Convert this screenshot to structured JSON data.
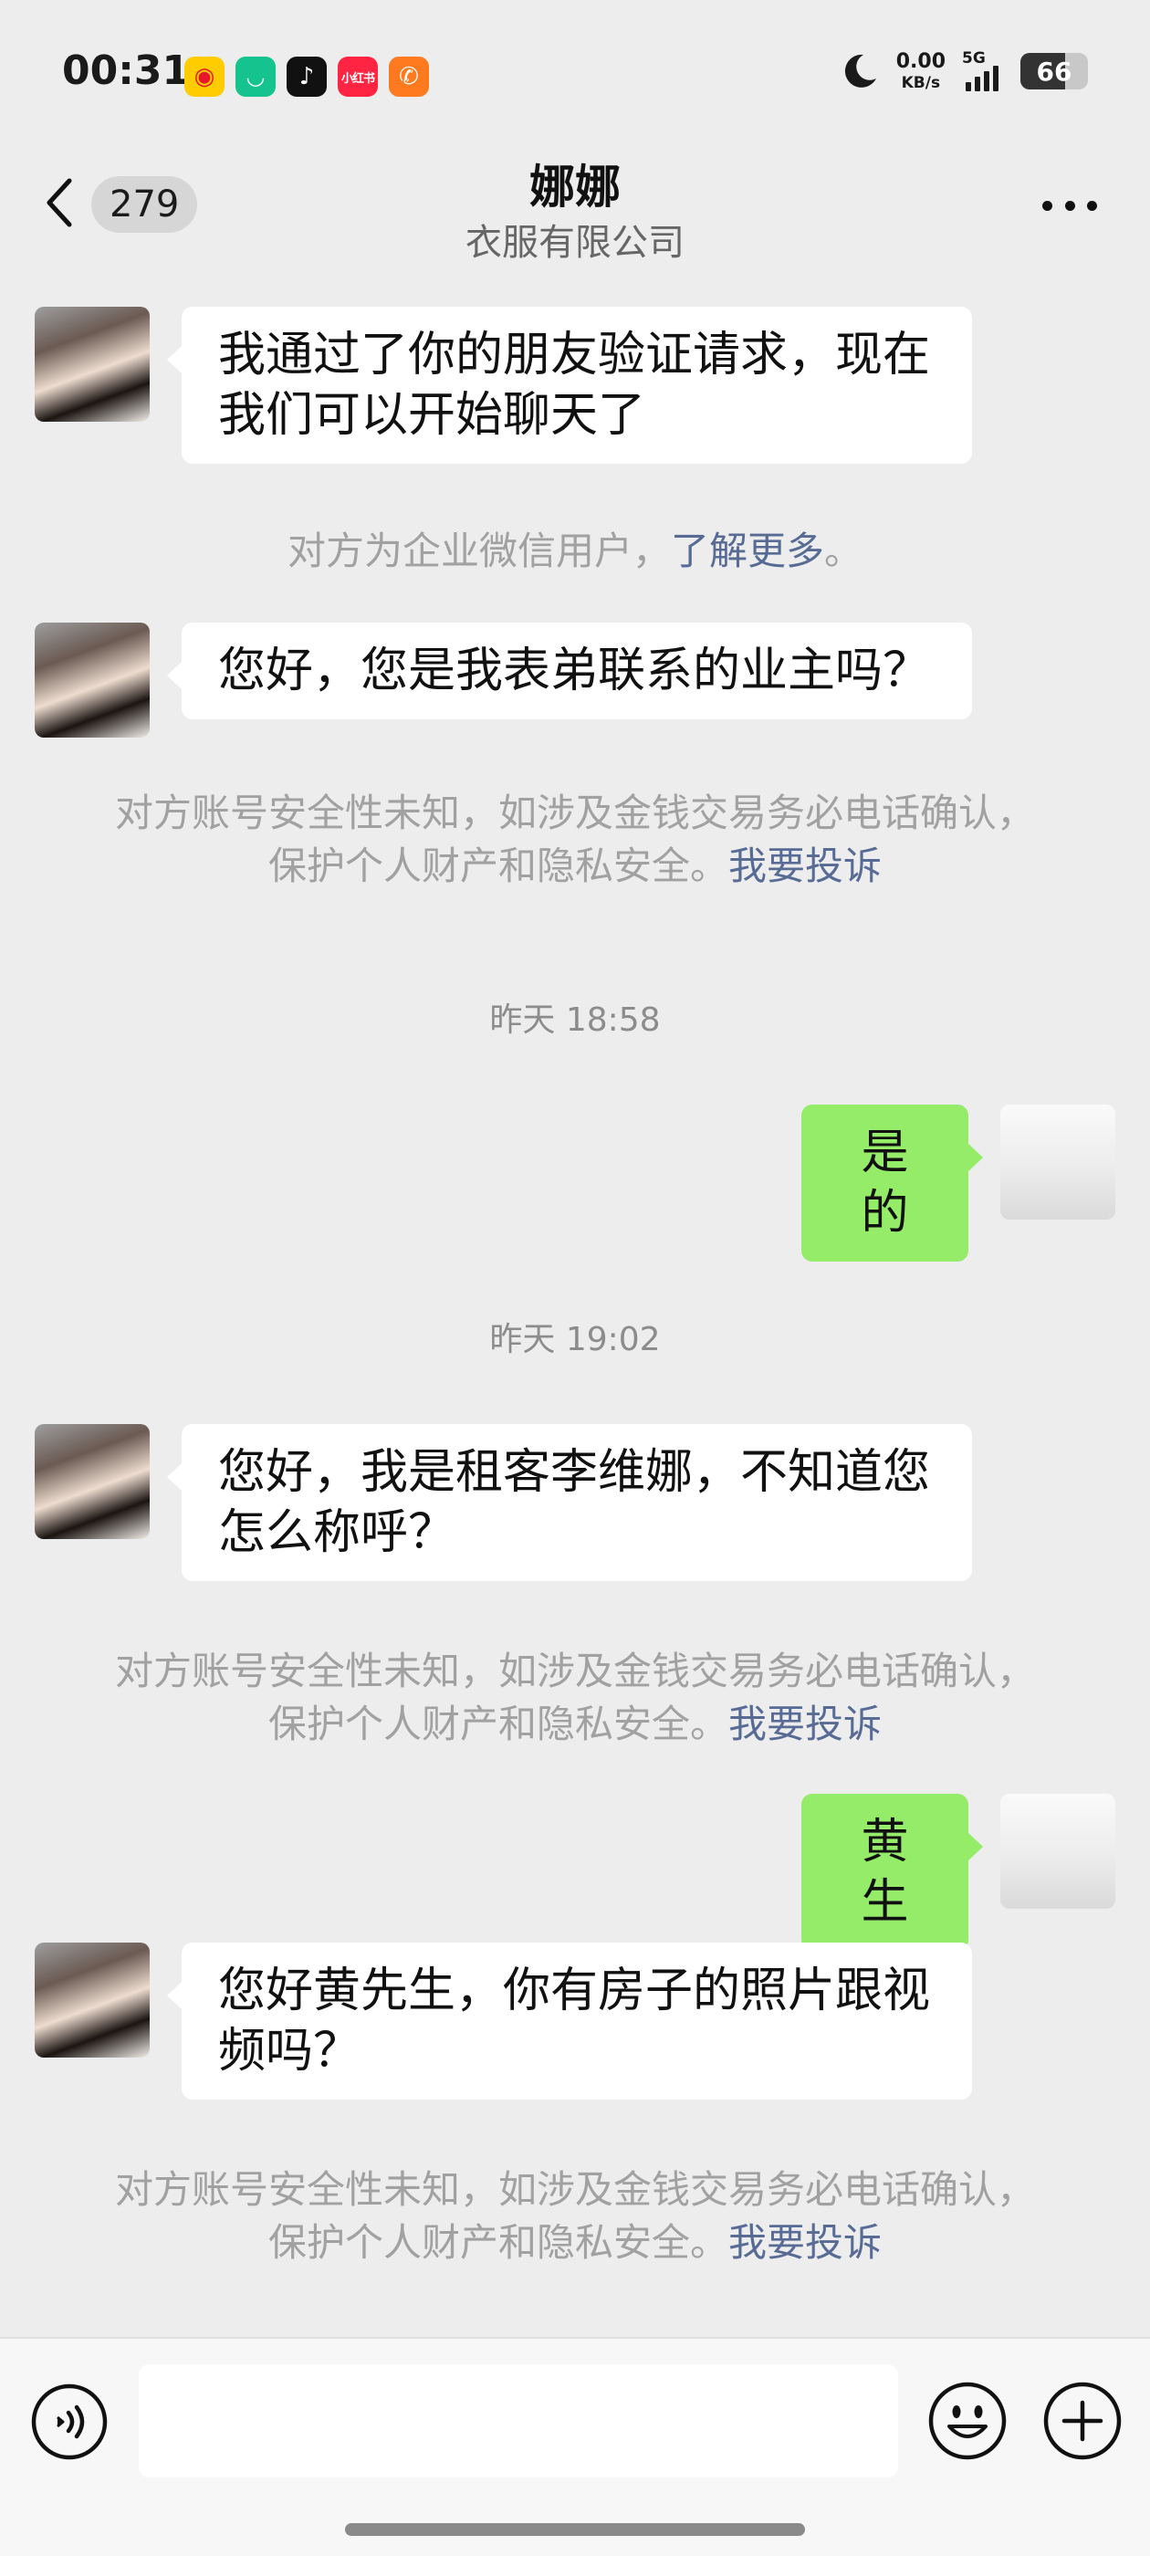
{
  "status_bar": {
    "time": "00:31",
    "apps": [
      "weibo-icon",
      "mi-icon",
      "tiktok-icon",
      "xiaohongshu-icon",
      "phone-icon"
    ],
    "xiaohongshu_label": "小红书",
    "net_speed_value": "0.00",
    "net_speed_unit": "KB/s",
    "network": "5G",
    "battery": "66",
    "battery_level": 66
  },
  "header": {
    "unread_count": "279",
    "title": "娜娜",
    "subtitle": "衣服有限公司"
  },
  "messages": {
    "m1_text": "我通过了你的朋友验证请求，现在我们可以开始聊天了",
    "note_enterprise_text": "对方为企业微信用户，",
    "note_enterprise_link": "了解更多",
    "note_enterprise_end": "。",
    "m2_text": "您好，您是我表弟联系的业主吗？",
    "security_note_line1": "对方账号安全性未知，如涉及金钱交易务必电话确认，",
    "security_note_line2": "保护个人财产和隐私安全。",
    "security_note_link": "我要投诉",
    "time1": "昨天 18:58",
    "m3_text": "是的",
    "time2": "昨天 19:02",
    "m4_text": "您好，我是租客李维娜，不知道您怎么称呼？",
    "m5_text": "黄生",
    "m6_text": "您好黄先生，你有房子的照片跟视频吗？"
  },
  "input_bar": {
    "text_value": "",
    "icons": [
      "voice-icon",
      "emoji-icon",
      "plus-icon"
    ]
  },
  "colors": {
    "background": "#ededed",
    "incoming_bubble": "#ffffff",
    "outgoing_bubble": "#95ec69",
    "link": "#576b95",
    "note_text": "#a1a1a1"
  }
}
